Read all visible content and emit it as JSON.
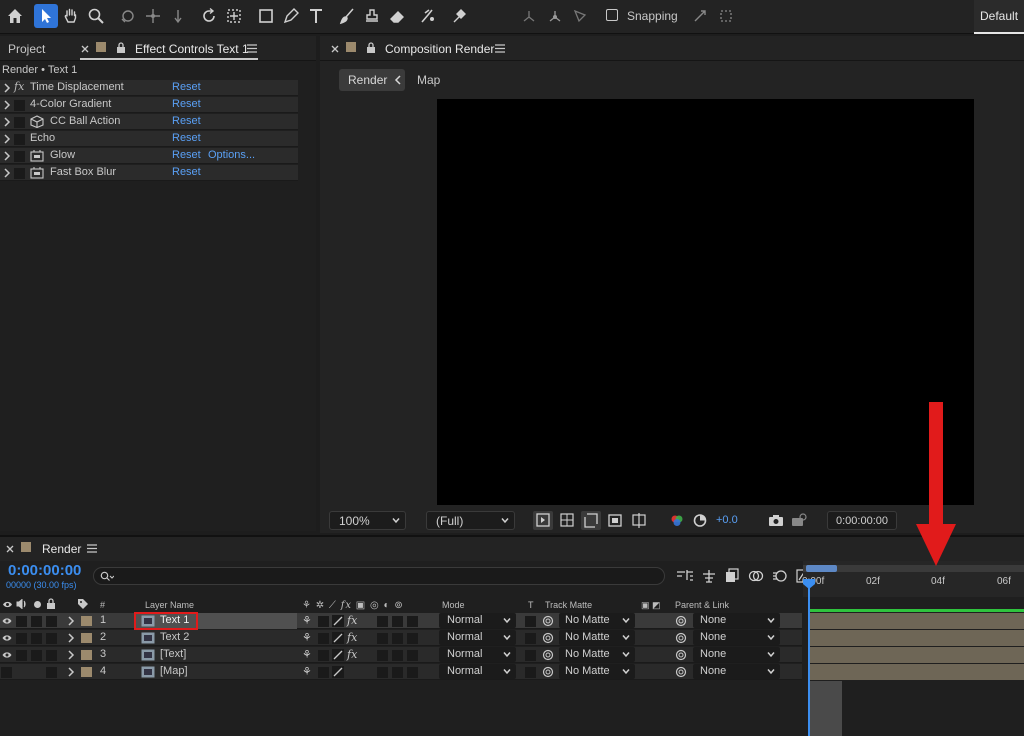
{
  "toolbar": {
    "snapping_label": "Snapping",
    "workspace_label": "Default"
  },
  "effect_controls": {
    "tab_project": "Project",
    "tab_effect_controls": "Effect Controls Text 1",
    "breadcrumb": "Render • Text 1",
    "effects": [
      {
        "name": "Time Displacement",
        "reset": "Reset"
      },
      {
        "name": "4-Color Gradient",
        "reset": "Reset"
      },
      {
        "name": "CC Ball Action",
        "reset": "Reset"
      },
      {
        "name": "Echo",
        "reset": "Reset"
      },
      {
        "name": "Glow",
        "reset": "Reset",
        "options": "Options..."
      },
      {
        "name": "Fast Box Blur",
        "reset": "Reset"
      }
    ]
  },
  "composition": {
    "tab_title": "Composition Render",
    "breadcrumb_active": "Render",
    "breadcrumb_next": "Map",
    "zoom": "100%",
    "resolution": "(Full)",
    "exposure": "+0.0",
    "timecode": "0:00:00:00"
  },
  "timeline": {
    "tab_title": "Render",
    "current_time": "0:00:00:00",
    "frame_info": "00000 (30.00 fps)",
    "columns": {
      "number": "#",
      "layer_name": "Layer Name",
      "mode": "Mode",
      "t": "T",
      "track_matte": "Track Matte",
      "parent": "Parent & Link"
    },
    "layers": [
      {
        "num": "1",
        "name": "Text 1",
        "mode": "Normal",
        "track_matte": "No Matte",
        "parent": "None"
      },
      {
        "num": "2",
        "name": "Text 2",
        "mode": "Normal",
        "track_matte": "No Matte",
        "parent": "None"
      },
      {
        "num": "3",
        "name": "[Text]",
        "mode": "Normal",
        "track_matte": "No Matte",
        "parent": "None"
      },
      {
        "num": "4",
        "name": "[Map]",
        "mode": "Normal",
        "track_matte": "No Matte",
        "parent": "None"
      }
    ],
    "ruler_ticks": [
      "0:00f",
      "02f",
      "04f",
      "06f"
    ]
  },
  "colors": {
    "accent": "#2f74d8",
    "link": "#5aa0f5",
    "highlight": "#e11b1b",
    "label_sand": "#9c8a6d"
  }
}
